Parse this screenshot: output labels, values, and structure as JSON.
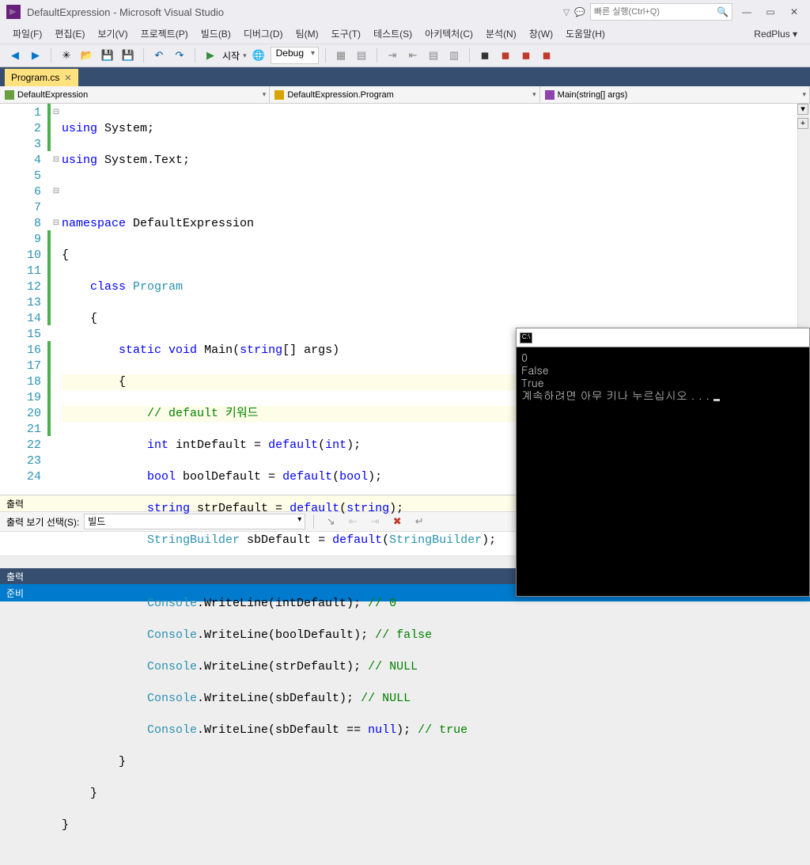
{
  "window": {
    "title": "DefaultExpression - Microsoft Visual Studio",
    "search_placeholder": "빠른 실행(Ctrl+Q)"
  },
  "menu": {
    "file": "파일(F)",
    "edit": "편집(E)",
    "view": "보기(V)",
    "project": "프로젝트(P)",
    "build": "빌드(B)",
    "debug": "디버그(D)",
    "team": "팀(M)",
    "tools": "도구(T)",
    "test": "테스트(S)",
    "arch": "아키텍처(C)",
    "analyze": "분석(N)",
    "window": "창(W)",
    "help": "도움말(H)",
    "user": "RedPlus ▾"
  },
  "toolbar": {
    "start": "시작",
    "config": "Debug"
  },
  "tab": {
    "active": "Program.cs"
  },
  "nav": {
    "left": "DefaultExpression",
    "mid": "DefaultExpression.Program",
    "right": "Main(string[] args)"
  },
  "code": {
    "l1a": "using",
    "l1b": " System;",
    "l2a": "using",
    "l2b": " System.Text;",
    "l4a": "namespace",
    "l4b": " DefaultExpression",
    "l5": "{",
    "l6a": "    class",
    "l6b": " ",
    "l6c": "Program",
    "l7": "    {",
    "l8a": "        static",
    "l8b": " ",
    "l8c": "void",
    "l8d": " Main(",
    "l8e": "string",
    "l8f": "[] args)",
    "l9": "        {",
    "l10": "            // default 키워드",
    "l11a": "            int",
    "l11b": " intDefault = ",
    "l11c": "default",
    "l11d": "(",
    "l11e": "int",
    "l11f": ");",
    "l12a": "            bool",
    "l12b": " boolDefault = ",
    "l12c": "default",
    "l12d": "(",
    "l12e": "bool",
    "l12f": ");",
    "l13a": "            string",
    "l13b": " strDefault = ",
    "l13c": "default",
    "l13d": "(",
    "l13e": "string",
    "l13f": ");",
    "l14a": "            StringBuilder",
    "l14b": " sbDefault = ",
    "l14c": "default",
    "l14d": "(",
    "l14e": "StringBuilder",
    "l14f": ");",
    "l16a": "            Console",
    "l16b": ".WriteLine(intDefault); ",
    "l16c": "// 0",
    "l17a": "            Console",
    "l17b": ".WriteLine(boolDefault); ",
    "l17c": "// false",
    "l18a": "            Console",
    "l18b": ".WriteLine(strDefault); ",
    "l18c": "// NULL",
    "l19a": "            Console",
    "l19b": ".WriteLine(sbDefault); ",
    "l19c": "// NULL",
    "l20a": "            Console",
    "l20b": ".WriteLine(sbDefault == ",
    "l20c": "null",
    "l20d": "); ",
    "l20e": "// true",
    "l21": "        }",
    "l22": "    }",
    "l23": "}"
  },
  "lines": [
    "1",
    "2",
    "3",
    "4",
    "5",
    "6",
    "7",
    "8",
    "9",
    "10",
    "11",
    "12",
    "13",
    "14",
    "15",
    "16",
    "17",
    "18",
    "19",
    "20",
    "21",
    "22",
    "23",
    "24"
  ],
  "output": {
    "title": "출력",
    "label": "출력 보기 선택(S):",
    "source": "빌드",
    "tab": "출력"
  },
  "status": {
    "text": "준비"
  },
  "console": {
    "l1": "0",
    "l2": "False",
    "l3": "",
    "l4": "",
    "l5": "True",
    "l6": "계속하려면 아무 키나 누르십시오 . . . "
  }
}
